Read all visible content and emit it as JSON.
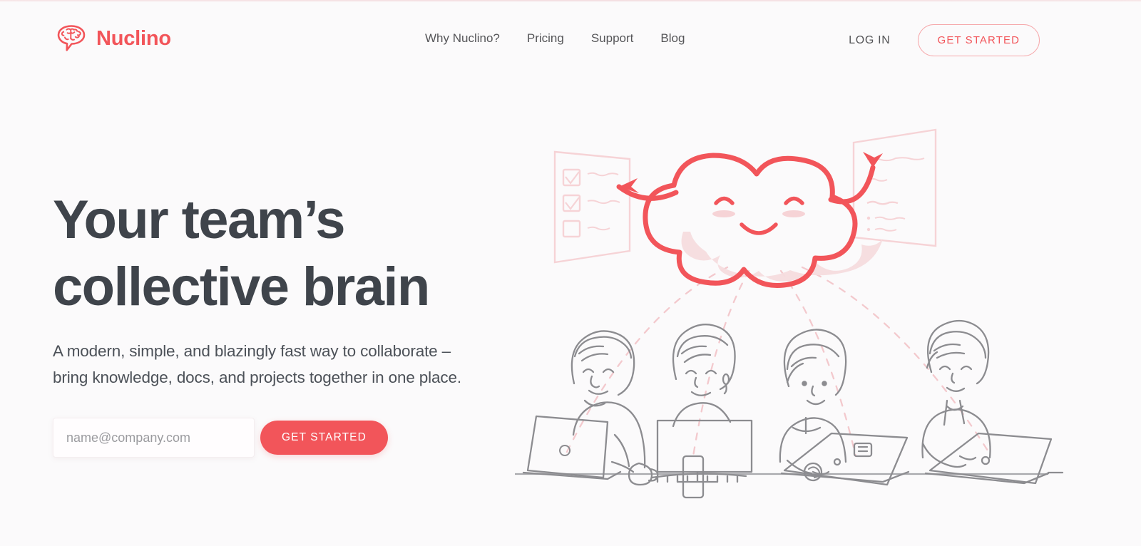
{
  "brand": {
    "name": "Nuclino",
    "accent_color": "#f2555a",
    "accent_light": "#f6c9cc",
    "text_color": "#3f444b",
    "background": "#fbfafb",
    "line_art_color": "#8c8c90"
  },
  "header": {
    "logo_icon": "brain-speech-bubble-icon",
    "logo_text": "Nuclino",
    "nav": [
      {
        "label": "Why Nuclino?"
      },
      {
        "label": "Pricing"
      },
      {
        "label": "Support"
      },
      {
        "label": "Blog"
      }
    ],
    "login_label": "LOG IN",
    "cta_label": "GET STARTED"
  },
  "hero": {
    "headline_line1": "Your team’s",
    "headline_line2": "collective brain",
    "subtitle_line1": "A modern, simple, and blazingly fast way to collaborate –",
    "subtitle_line2": "bring knowledge, docs, and projects together in one place.",
    "email_placeholder": "name@company.com",
    "email_value": "",
    "cta_label": "GET STARTED"
  },
  "illustration": {
    "description": "Smiling cloud with arms pointing to a checklist board and a notes board, dashed arcs connecting down to four people working at a shared desk",
    "cloud_icon": "smiling-cloud-icon",
    "left_board_icon": "checklist-board-icon",
    "right_board_icon": "notes-board-icon",
    "people_count": 4,
    "dashed_arc_count": 4,
    "people": [
      {
        "name": "person-laptop-left",
        "device": "laptop"
      },
      {
        "name": "person-monitor",
        "device": "desktop-monitor"
      },
      {
        "name": "person-laptop-stickers",
        "device": "laptop"
      },
      {
        "name": "person-laptop-right",
        "device": "laptop"
      }
    ],
    "desk_items": [
      "coffee-mug",
      "keyboard",
      "smartphone"
    ]
  }
}
